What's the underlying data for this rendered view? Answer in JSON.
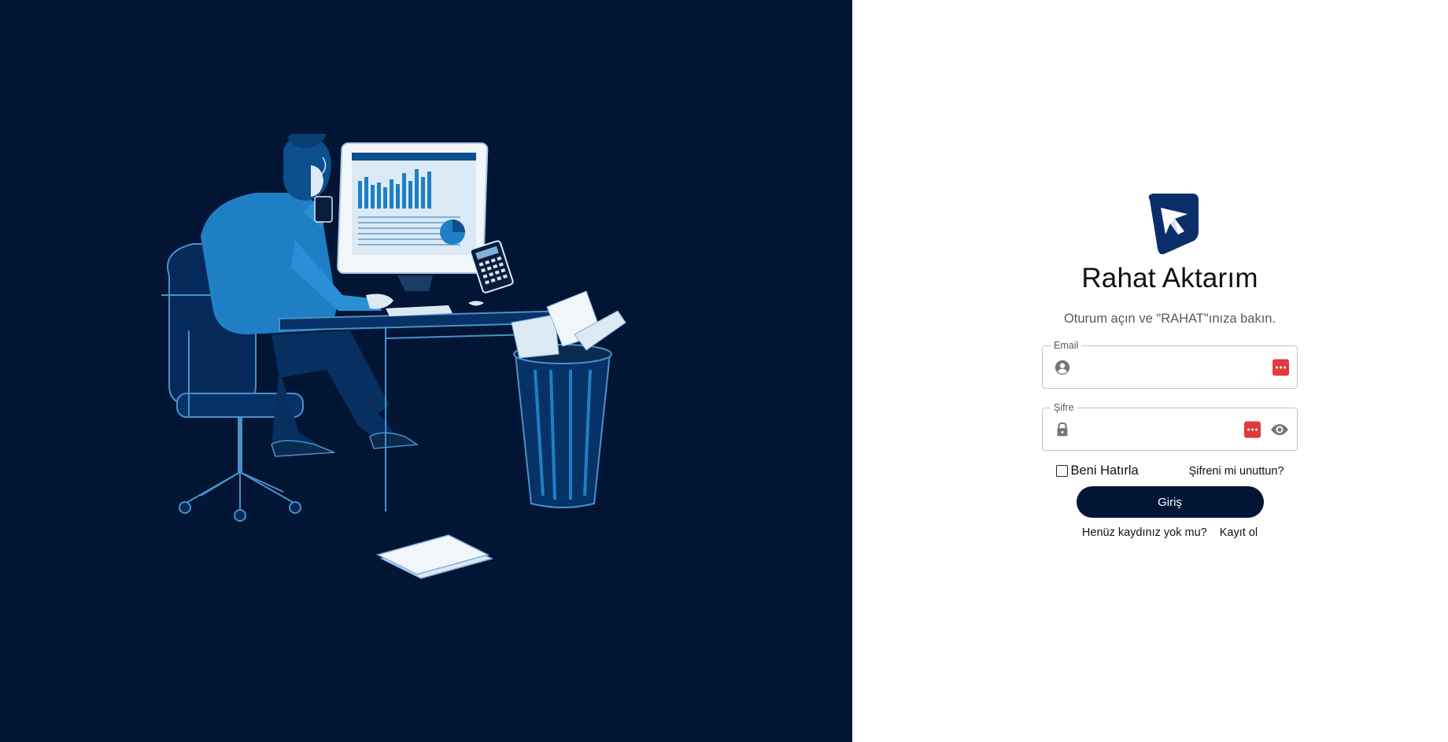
{
  "brand": {
    "title": "Rahat Aktarım",
    "subtitle": "Oturum açın ve \"RAHAT\"ınıza bakın.",
    "primary_color": "#031535",
    "logo_icon": "paper-plane-logo-icon"
  },
  "form": {
    "email": {
      "label": "Email",
      "value": "",
      "icon": "account-circle-icon"
    },
    "password": {
      "label": "Şifre",
      "value": "",
      "icon": "lock-icon",
      "toggle_icon": "eye-icon"
    },
    "password_manager_badge_color": "#e03a3a",
    "remember_me": {
      "label": "Beni Hatırla",
      "checked": false
    },
    "forgot_password_label": "Şifreni mi unuttun?",
    "submit_label": "Giriş",
    "no_account_text": "Henüz kaydınız yok mu?",
    "register_label": "Kayıt ol"
  }
}
